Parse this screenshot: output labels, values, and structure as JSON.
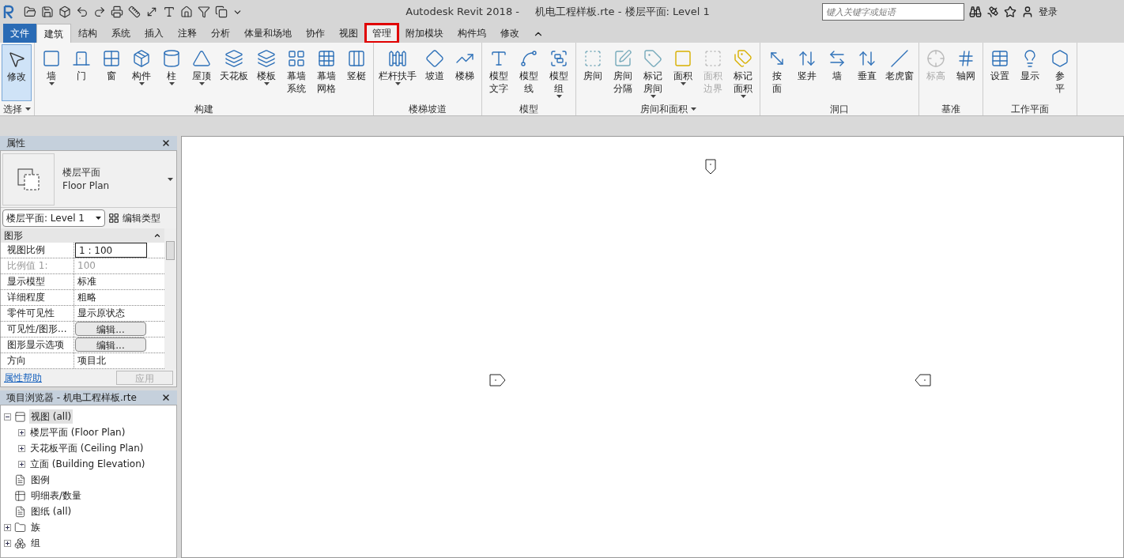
{
  "title_bar": {
    "app": "Autodesk Revit 2018 -",
    "document": "机电工程样板.rte - 楼层平面: Level 1",
    "search": {
      "placeholder": "键入关键字或短语"
    },
    "sign_in": "登录"
  },
  "tabs": [
    {
      "label": "文件",
      "kind": "file",
      "selected": false,
      "highlighted": false
    },
    {
      "label": "建筑",
      "kind": "tab",
      "selected": true,
      "highlighted": false
    },
    {
      "label": "结构",
      "kind": "tab",
      "selected": false,
      "highlighted": false
    },
    {
      "label": "系统",
      "kind": "tab",
      "selected": false,
      "highlighted": false
    },
    {
      "label": "插入",
      "kind": "tab",
      "selected": false,
      "highlighted": false
    },
    {
      "label": "注释",
      "kind": "tab",
      "selected": false,
      "highlighted": false
    },
    {
      "label": "分析",
      "kind": "tab",
      "selected": false,
      "highlighted": false
    },
    {
      "label": "体量和场地",
      "kind": "tab",
      "selected": false,
      "highlighted": false
    },
    {
      "label": "协作",
      "kind": "tab",
      "selected": false,
      "highlighted": false
    },
    {
      "label": "视图",
      "kind": "tab",
      "selected": false,
      "highlighted": false
    },
    {
      "label": "管理",
      "kind": "tab",
      "selected": false,
      "highlighted": true
    },
    {
      "label": "附加模块",
      "kind": "tab",
      "selected": false,
      "highlighted": false
    },
    {
      "label": "构件坞",
      "kind": "tab",
      "selected": false,
      "highlighted": false
    },
    {
      "label": "修改",
      "kind": "tab",
      "selected": false,
      "highlighted": false
    }
  ],
  "ribbon": [
    {
      "label": "选择",
      "dropdown": true,
      "tools": [
        {
          "label": "修改",
          "dropdown": false,
          "disabled": false,
          "selected": true
        }
      ]
    },
    {
      "label": "构建",
      "dropdown": false,
      "tools": [
        {
          "label": "墙",
          "dropdown": true,
          "disabled": false,
          "selected": false
        },
        {
          "label": "门",
          "dropdown": false,
          "disabled": false,
          "selected": false
        },
        {
          "label": "窗",
          "dropdown": false,
          "disabled": false,
          "selected": false
        },
        {
          "label": "构件",
          "dropdown": true,
          "disabled": false,
          "selected": false
        },
        {
          "label": "柱",
          "dropdown": true,
          "disabled": false,
          "selected": false
        },
        {
          "label": "屋顶",
          "dropdown": true,
          "disabled": false,
          "selected": false
        },
        {
          "label": "天花板",
          "dropdown": false,
          "disabled": false,
          "selected": false
        },
        {
          "label": "楼板",
          "dropdown": true,
          "disabled": false,
          "selected": false
        },
        {
          "label": [
            "幕墙",
            "系统"
          ],
          "dropdown": false,
          "disabled": false,
          "selected": false
        },
        {
          "label": [
            "幕墙",
            "网格"
          ],
          "dropdown": false,
          "disabled": false,
          "selected": false
        },
        {
          "label": "竖梃",
          "dropdown": false,
          "disabled": false,
          "selected": false
        }
      ]
    },
    {
      "label": "楼梯坡道",
      "dropdown": false,
      "tools": [
        {
          "label": "栏杆扶手",
          "dropdown": true,
          "disabled": false,
          "selected": false
        },
        {
          "label": "坡道",
          "dropdown": false,
          "disabled": false,
          "selected": false
        },
        {
          "label": "楼梯",
          "dropdown": false,
          "disabled": false,
          "selected": false
        }
      ]
    },
    {
      "label": "模型",
      "dropdown": false,
      "tools": [
        {
          "label": [
            "模型",
            "文字"
          ],
          "dropdown": false,
          "disabled": false,
          "selected": false
        },
        {
          "label": [
            "模型",
            "线"
          ],
          "dropdown": false,
          "disabled": false,
          "selected": false
        },
        {
          "label": [
            "模型",
            "组"
          ],
          "dropdown": true,
          "disabled": false,
          "selected": false
        }
      ]
    },
    {
      "label": "房间和面积",
      "dropdown": true,
      "tools": [
        {
          "label": "房间",
          "dropdown": false,
          "disabled": false,
          "selected": false
        },
        {
          "label": [
            "房间",
            "分隔"
          ],
          "dropdown": false,
          "disabled": false,
          "selected": false
        },
        {
          "label": [
            "标记",
            "房间"
          ],
          "dropdown": true,
          "disabled": false,
          "selected": false
        },
        {
          "label": "面积",
          "dropdown": true,
          "disabled": false,
          "selected": false
        },
        {
          "label": [
            "面积",
            "边界"
          ],
          "dropdown": false,
          "disabled": true,
          "selected": false
        },
        {
          "label": [
            "标记",
            "面积"
          ],
          "dropdown": true,
          "disabled": false,
          "selected": false
        }
      ]
    },
    {
      "label": "洞口",
      "dropdown": false,
      "tools": [
        {
          "label": [
            "按",
            "面"
          ],
          "dropdown": false,
          "disabled": false,
          "selected": false
        },
        {
          "label": "竖井",
          "dropdown": false,
          "disabled": false,
          "selected": false
        },
        {
          "label": "墙",
          "dropdown": false,
          "disabled": false,
          "selected": false
        },
        {
          "label": "垂直",
          "dropdown": false,
          "disabled": false,
          "selected": false
        },
        {
          "label": "老虎窗",
          "dropdown": false,
          "disabled": false,
          "selected": false
        }
      ]
    },
    {
      "label": "基准",
      "dropdown": false,
      "tools": [
        {
          "label": "标高",
          "dropdown": false,
          "disabled": true,
          "selected": false
        },
        {
          "label": "轴网",
          "dropdown": false,
          "disabled": false,
          "selected": false
        }
      ]
    },
    {
      "label": "工作平面",
      "dropdown": false,
      "tools": [
        {
          "label": "设置",
          "dropdown": false,
          "disabled": false,
          "selected": false
        },
        {
          "label": "显示",
          "dropdown": false,
          "disabled": false,
          "selected": false
        },
        {
          "label": [
            "参",
            "平"
          ],
          "dropdown": false,
          "disabled": false,
          "selected": false
        }
      ]
    }
  ],
  "properties": {
    "title": "属性",
    "type_name": "楼层平面",
    "type_name_en": "Floor Plan",
    "selector": "楼层平面: Level 1",
    "edit_type": "编辑类型",
    "group": "图形",
    "rows": [
      {
        "name": "视图比例",
        "value": "1 : 100",
        "kind": "input",
        "disabled": false
      },
      {
        "name": "比例值 1:",
        "value": "100",
        "kind": "text",
        "disabled": true
      },
      {
        "name": "显示模型",
        "value": "标准",
        "kind": "text",
        "disabled": false
      },
      {
        "name": "详细程度",
        "value": "粗略",
        "kind": "text",
        "disabled": false
      },
      {
        "name": "零件可见性",
        "value": "显示原状态",
        "kind": "text",
        "disabled": false
      },
      {
        "name": "可见性/图形...",
        "value": "编辑...",
        "kind": "button",
        "disabled": false
      },
      {
        "name": "图形显示选项",
        "value": "编辑...",
        "kind": "button",
        "disabled": false
      },
      {
        "name": "方向",
        "value": "项目北",
        "kind": "text",
        "disabled": false
      }
    ],
    "help_link": "属性帮助",
    "apply": {
      "label": "应用",
      "disabled": true
    }
  },
  "browser": {
    "title": "项目浏览器 - 机电工程样板.rte",
    "tree": [
      {
        "label": "视图 (all)",
        "expanded": true,
        "selected": true,
        "children": [
          {
            "label": "楼层平面 (Floor Plan)",
            "expanded": false,
            "selected": false
          },
          {
            "label": "天花板平面 (Ceiling Plan)",
            "expanded": false,
            "selected": false
          },
          {
            "label": "立面 (Building Elevation)",
            "expanded": false,
            "selected": false
          }
        ]
      },
      {
        "label": "图例",
        "selected": false
      },
      {
        "label": "明细表/数量",
        "selected": false
      },
      {
        "label": "图纸 (all)",
        "selected": false
      },
      {
        "label": "族",
        "expanded": false,
        "selected": false
      },
      {
        "label": "组",
        "expanded": false,
        "selected": false
      }
    ]
  }
}
